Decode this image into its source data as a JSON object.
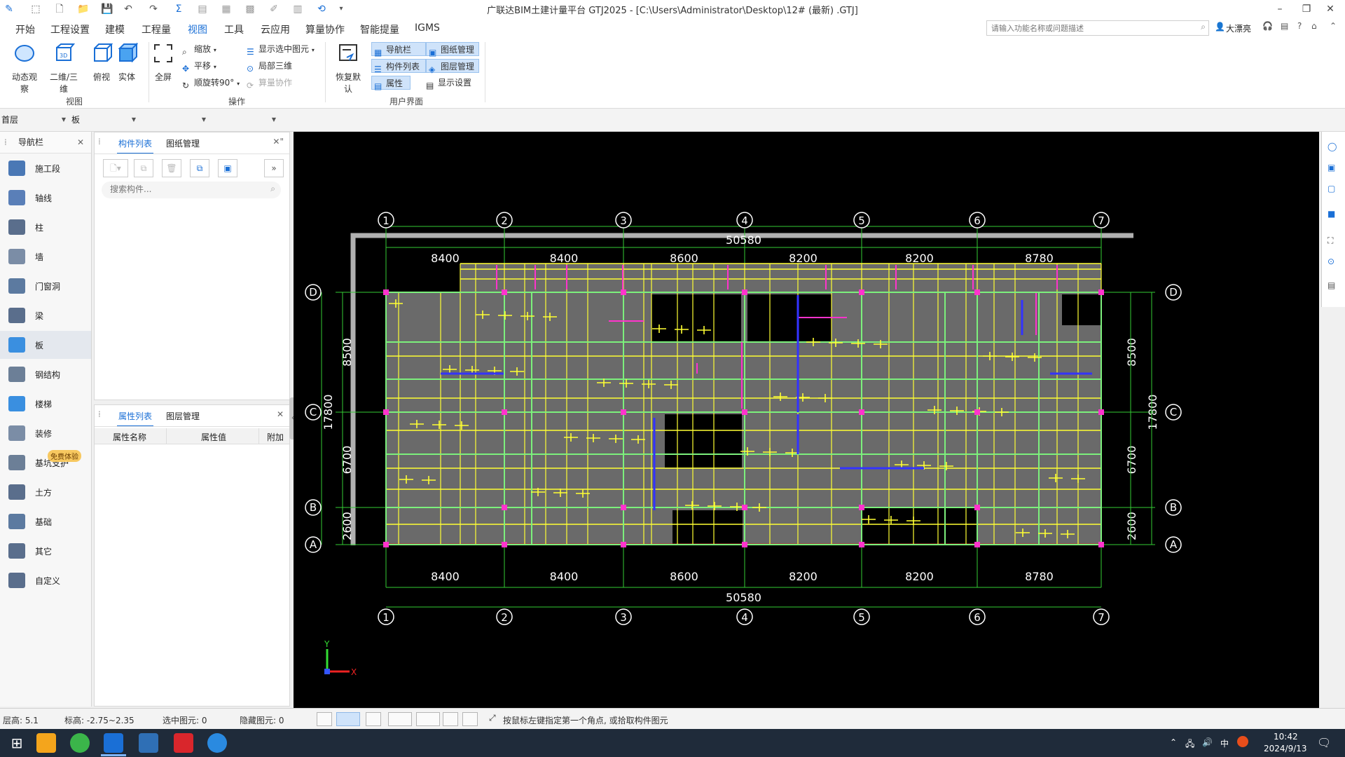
{
  "window": {
    "title": "广联达BIM土建计量平台 GTJ2025 - [C:\\Users\\Administrator\\Desktop\\12# (最新) .GTJ]"
  },
  "menu": {
    "items": [
      "开始",
      "工程设置",
      "建模",
      "工程量",
      "视图",
      "工具",
      "云应用",
      "算量协作",
      "智能提量",
      "IGMS"
    ],
    "active": "视图",
    "search_placeholder": "请输入功能名称或问题描述",
    "user_name": "大漂亮"
  },
  "ribbon": {
    "view_group": {
      "label": "视图",
      "buttons": [
        "动态观察",
        "二维/三维",
        "俯视",
        "实体"
      ]
    },
    "operate_group": {
      "label": "操作",
      "fullscreen": "全屏",
      "zoom": "缩放",
      "pan": "平移",
      "rotate": "顺旋转90°",
      "show_selected": "显示选中图元",
      "local_3d": "局部三维",
      "calc_collab": "算量协作"
    },
    "ui_group": {
      "label": "用户界面",
      "restore": "恢复默认",
      "nav": "导航栏",
      "comp_list": "构件列表",
      "property": "属性",
      "drawing_mgmt": "图纸管理",
      "layer_mgmt": "图层管理",
      "display_settings": "显示设置"
    }
  },
  "floorbar": {
    "floor": "首层",
    "category": "板",
    "sub1": "",
    "sub2": ""
  },
  "nav_panel": {
    "title": "导航栏",
    "items": [
      "施工段",
      "轴线",
      "柱",
      "墙",
      "门窗洞",
      "梁",
      "板",
      "钢结构",
      "楼梯",
      "装修",
      "基坑支护",
      "土方",
      "基础",
      "其它",
      "自定义"
    ],
    "active": "板",
    "badge": "免费体验"
  },
  "component_panel": {
    "tabs": [
      "构件列表",
      "图纸管理"
    ],
    "search_placeholder": "搜索构件..."
  },
  "property_panel": {
    "tabs": [
      "属性列表",
      "图层管理"
    ],
    "columns": [
      "属性名称",
      "属性值",
      "附加"
    ]
  },
  "drawing": {
    "axes_numbers": [
      "1",
      "2",
      "3",
      "4",
      "5",
      "6",
      "7"
    ],
    "axes_letters": [
      "D",
      "C",
      "B",
      "A"
    ],
    "top_total": "50580",
    "bottom_total": "50580",
    "spans": [
      "8400",
      "8400",
      "8600",
      "8200",
      "8200",
      "8780"
    ],
    "vertical_spans": [
      "8500",
      "6700",
      "2600"
    ],
    "vertical_total": "17800",
    "axis_x_label": "X",
    "axis_y_label": "Y"
  },
  "statusbar": {
    "floor_height": "层高:  5.1",
    "elevation": "标高:  -2.75~2.35",
    "selected": "选中图元:  0",
    "hidden": "隐藏图元:  0",
    "hint": "按鼠标左键指定第一个角点, 或拾取构件图元"
  },
  "taskbar": {
    "ime": "中",
    "time": "10:42",
    "date": "2024/9/13"
  },
  "colors": {
    "accent": "#1a6fd6",
    "grid_green": "#33cc33",
    "slab_fill": "#6a6a6a",
    "beam_yellow": "#ffff33",
    "rebar_magenta": "#ff33cc",
    "rebar_blue": "#3333ff"
  }
}
